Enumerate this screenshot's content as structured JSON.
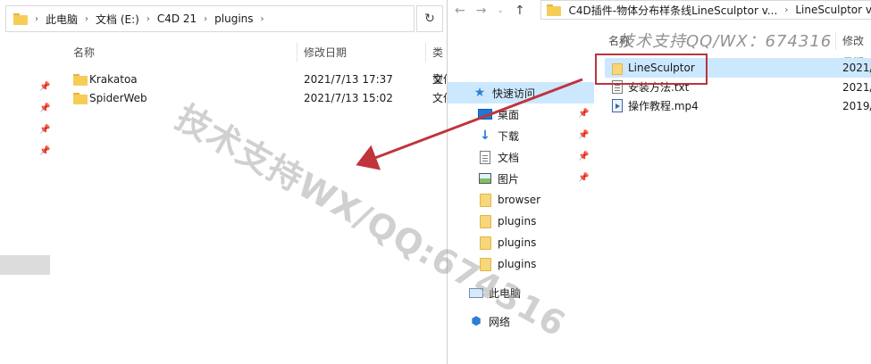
{
  "left_window": {
    "breadcrumb": [
      "此电脑",
      "文档 (E:)",
      "C4D 21",
      "plugins"
    ],
    "columns": [
      "名称",
      "修改日期",
      "类型"
    ],
    "files": [
      {
        "name": "Krakatoa",
        "date": "2021/7/13 17:37",
        "type": "文件"
      },
      {
        "name": "SpiderWeb",
        "date": "2021/7/13 15:02",
        "type": "文件"
      }
    ],
    "refresh_icon": "refresh-icon"
  },
  "right_window": {
    "breadcrumb": [
      "C4D插件-物体分布样条线LineSculptor v...",
      "LineSculptor v"
    ],
    "nav": [
      {
        "label": "快速访问",
        "icon": "star-icon"
      },
      {
        "label": "桌面",
        "icon": "desktop-icon"
      },
      {
        "label": "下载",
        "icon": "download-icon"
      },
      {
        "label": "文档",
        "icon": "document-icon"
      },
      {
        "label": "图片",
        "icon": "picture-icon"
      },
      {
        "label": "browser",
        "icon": "folder-icon"
      },
      {
        "label": "plugins",
        "icon": "folder-icon"
      },
      {
        "label": "plugins",
        "icon": "folder-icon"
      },
      {
        "label": "plugins",
        "icon": "folder-icon"
      },
      {
        "label": "此电脑",
        "icon": "computer-icon"
      },
      {
        "label": "网络",
        "icon": "network-icon"
      }
    ],
    "columns": [
      "名称",
      "修改日期"
    ],
    "files": [
      {
        "name": "LineSculptor",
        "date": "2021/",
        "icon": "folder-icon"
      },
      {
        "name": "安装方法.txt",
        "date": "2021/",
        "icon": "text-file-icon"
      },
      {
        "name": "操作教程.mp4",
        "date": "2019/",
        "icon": "video-file-icon"
      }
    ]
  },
  "watermarks": {
    "diagonal": "技术支持WX/QQ:674316",
    "top_right": "技术支持QQ/WX：674316"
  },
  "colors": {
    "highlight_box": "#b8343d",
    "arrow": "#c0343c",
    "selection": "#cce8ff"
  }
}
